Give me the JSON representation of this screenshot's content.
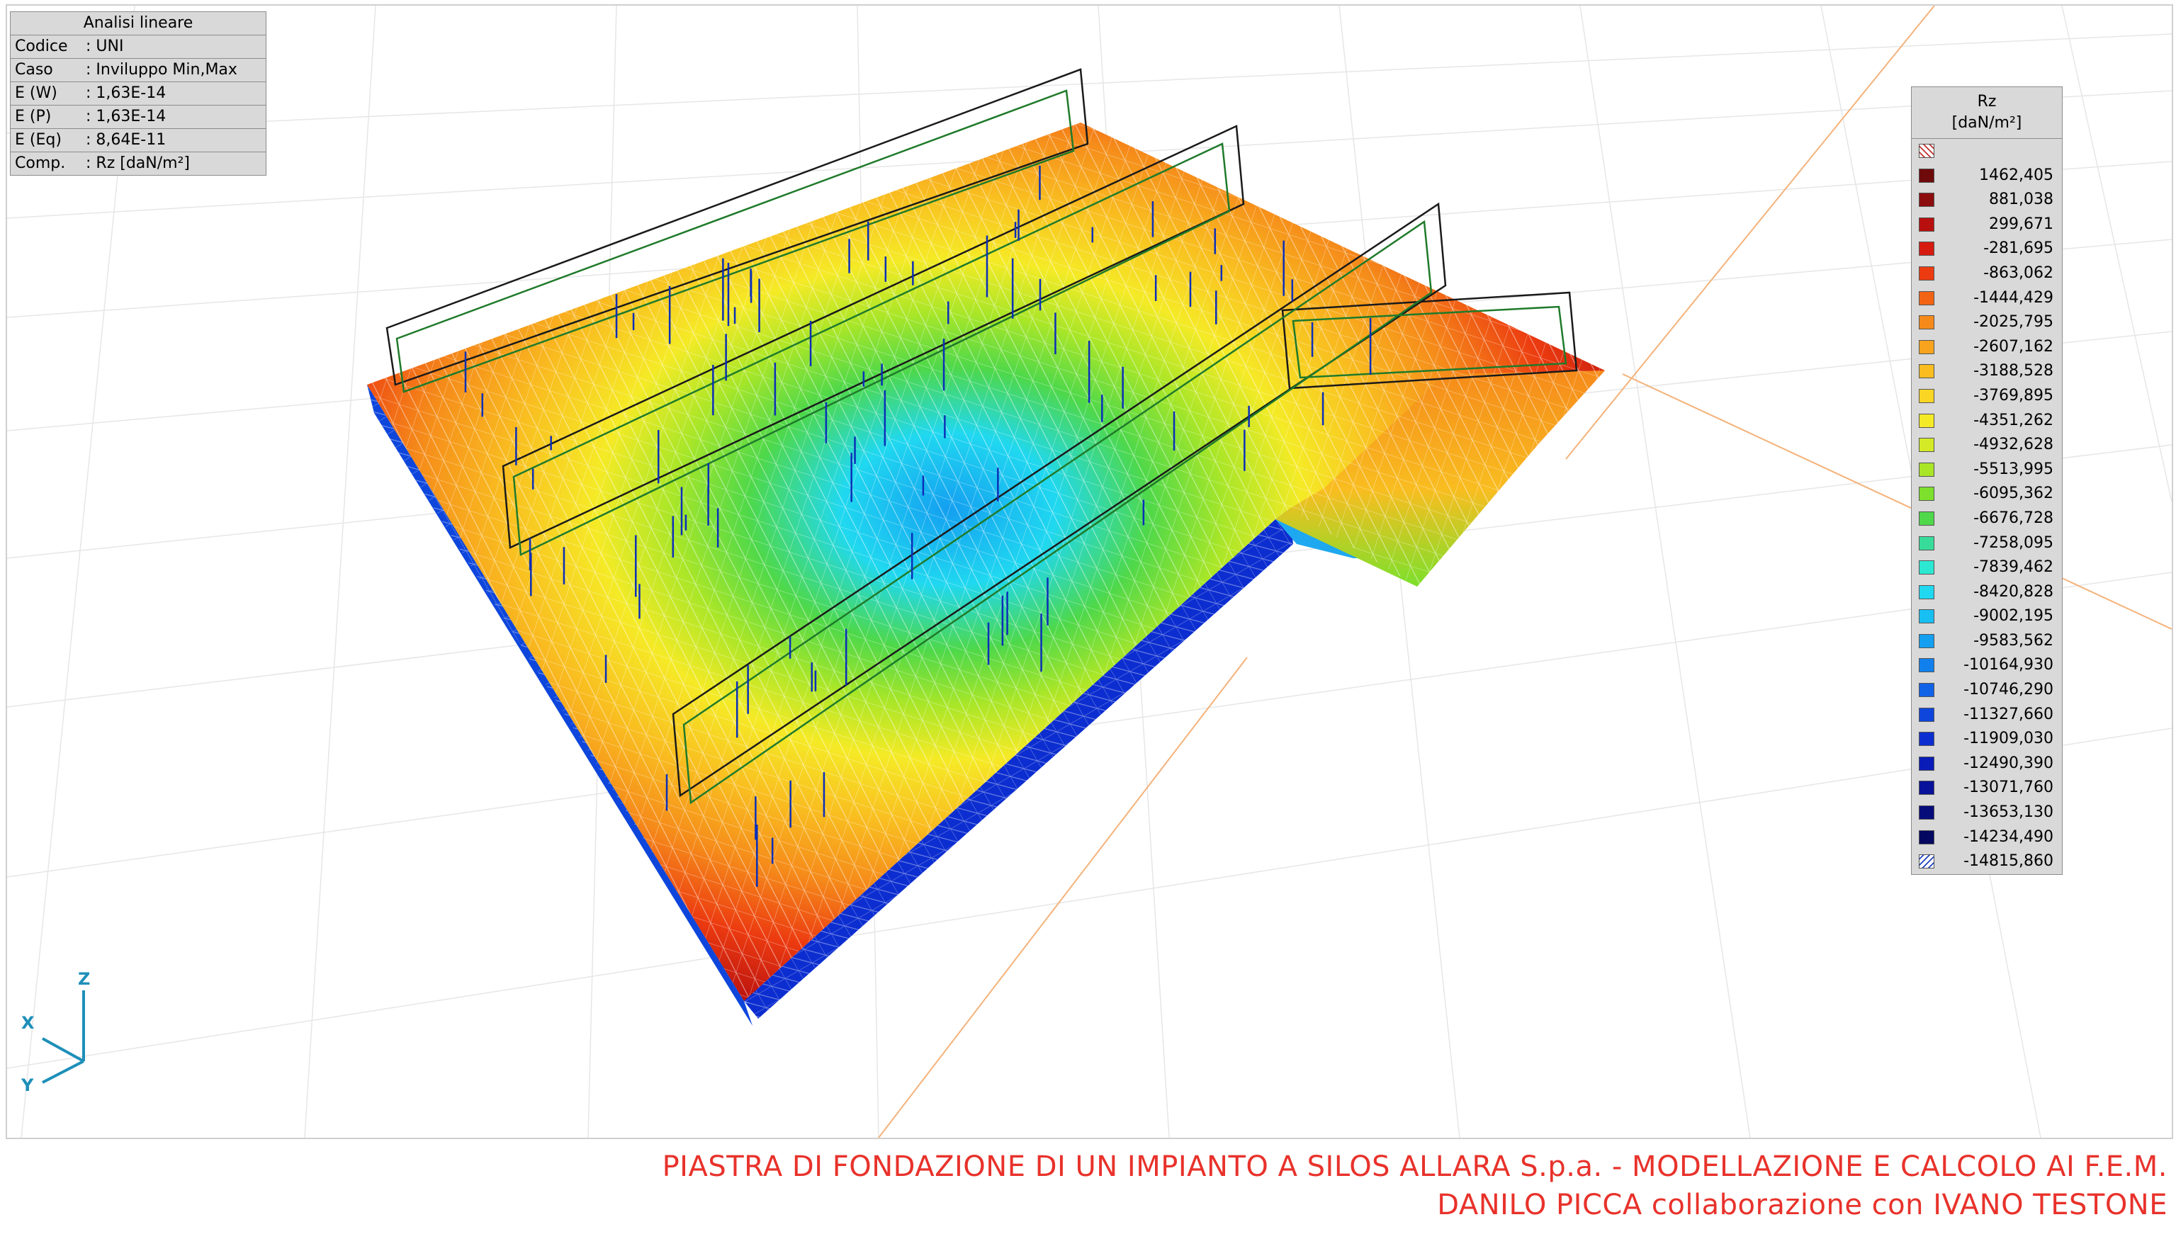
{
  "info_panel": {
    "title": "Analisi lineare",
    "rows": [
      {
        "key": "Codice",
        "value": "UNI"
      },
      {
        "key": "Caso",
        "value": "Inviluppo Min,Max"
      },
      {
        "key": "E (W)",
        "value": "1,63E-14"
      },
      {
        "key": "E (P)",
        "value": "1,63E-14"
      },
      {
        "key": "E (Eq)",
        "value": "8,64E-11"
      },
      {
        "key": "Comp.",
        "value": "Rz [daN/m²]"
      }
    ]
  },
  "legend": {
    "title": "Rz",
    "unit": "[daN/m²]",
    "entries": [
      {
        "label": "1462,405",
        "color": "#6e0a0a"
      },
      {
        "label": "881,038",
        "color": "#8c0d0d"
      },
      {
        "label": "299,671",
        "color": "#b80f0f"
      },
      {
        "label": "-281,695",
        "color": "#d61a10"
      },
      {
        "label": "-863,062",
        "color": "#ec3b10"
      },
      {
        "label": "-1444,429",
        "color": "#f26414"
      },
      {
        "label": "-2025,795",
        "color": "#f58a1a"
      },
      {
        "label": "-2607,162",
        "color": "#f7a31e"
      },
      {
        "label": "-3188,528",
        "color": "#f9bd20"
      },
      {
        "label": "-3769,895",
        "color": "#fbd524"
      },
      {
        "label": "-4351,262",
        "color": "#f5ea26"
      },
      {
        "label": "-4932,628",
        "color": "#d4ea26"
      },
      {
        "label": "-5513,995",
        "color": "#a9e628"
      },
      {
        "label": "-6095,362",
        "color": "#7ce02c"
      },
      {
        "label": "-6676,728",
        "color": "#4ed84a"
      },
      {
        "label": "-7258,095",
        "color": "#38dc9a"
      },
      {
        "label": "-7839,462",
        "color": "#2ce8d2"
      },
      {
        "label": "-8420,828",
        "color": "#20d8f0"
      },
      {
        "label": "-9002,195",
        "color": "#18bff2"
      },
      {
        "label": "-9583,562",
        "color": "#149ff0"
      },
      {
        "label": "-10164,930",
        "color": "#1280ec"
      },
      {
        "label": "-10746,290",
        "color": "#1062e6"
      },
      {
        "label": "-11327,660",
        "color": "#0e46dc"
      },
      {
        "label": "-11909,030",
        "color": "#0c2ed0"
      },
      {
        "label": "-12490,390",
        "color": "#0a1cb8"
      },
      {
        "label": "-13071,760",
        "color": "#08129a"
      },
      {
        "label": "-13653,130",
        "color": "#060c7a"
      },
      {
        "label": "-14234,490",
        "color": "#040860"
      },
      {
        "label": "-14815,860",
        "color": "#ffffff",
        "hatched": true
      }
    ],
    "top_hatched": true
  },
  "axes": {
    "x": "X",
    "y": "Y",
    "z": "Z"
  },
  "caption": {
    "line1": "PIASTRA DI FONDAZIONE DI UN IMPIANTO A SILOS ALLARA S.p.a. - MODELLAZIONE E CALCOLO AI F.E.M.",
    "line2": "DANILO PICCA collaborazione con IVANO TESTONE"
  }
}
